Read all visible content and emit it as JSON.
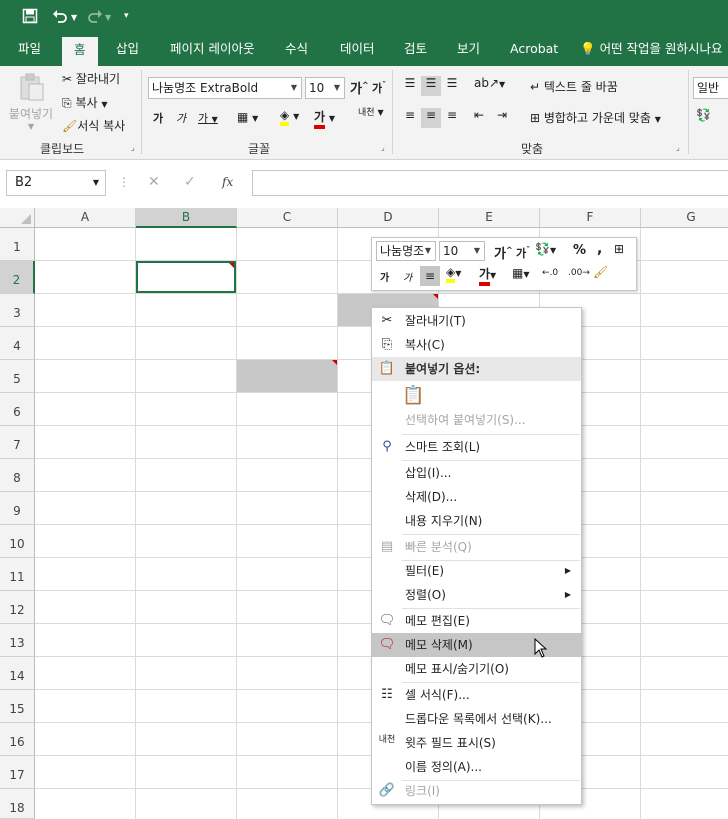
{
  "qat": {
    "save_icon": "save-icon",
    "undo_icon": "undo-icon",
    "redo_icon": "redo-icon",
    "customize_icon": "customize-icon"
  },
  "tabs": [
    {
      "label": "파일"
    },
    {
      "label": "홈"
    },
    {
      "label": "삽입"
    },
    {
      "label": "페이지 레이아웃"
    },
    {
      "label": "수식"
    },
    {
      "label": "데이터"
    },
    {
      "label": "검토"
    },
    {
      "label": "보기"
    },
    {
      "label": "Acrobat"
    }
  ],
  "tell_me": "어떤 작업을 원하시나요",
  "ribbon": {
    "clipboard": {
      "paste": "붙여넣기",
      "cut": "잘라내기",
      "copy": "복사",
      "format_painter": "서식 복사",
      "group": "클립보드"
    },
    "font": {
      "name": "나눔명조 ExtraBold",
      "size": "10",
      "group": "글꼴",
      "grow": "가",
      "shrink": "가",
      "bold": "가",
      "italic": "가",
      "underline": "가",
      "font_color_glyph": "가",
      "phonetic": "내천"
    },
    "alignment": {
      "wrap": "텍스트 줄 바꿈",
      "merge": "병합하고 가운데 맞춤",
      "group": "맞춤"
    },
    "number": {
      "format": "일반"
    }
  },
  "formula_bar": {
    "name_box": "B2",
    "fx": "fx"
  },
  "columns": [
    "A",
    "B",
    "C",
    "D",
    "E",
    "F",
    "G"
  ],
  "rows": [
    "1",
    "2",
    "3",
    "4",
    "5",
    "6",
    "7",
    "8",
    "9",
    "10",
    "11",
    "12",
    "13",
    "14",
    "15",
    "16",
    "17",
    "18"
  ],
  "mini_toolbar": {
    "font": "나눔명조",
    "size": "10",
    "percent": "%",
    "comma": ",",
    "bold": "가",
    "italic": "가",
    "font_color_glyph": "가"
  },
  "context_menu": {
    "cut": "잘라내기(T)",
    "copy": "복사(C)",
    "paste_options": "붙여넣기 옵션:",
    "paste_special": "선택하여 붙여넣기(S)...",
    "smart_lookup": "스마트 조회(L)",
    "insert": "삽입(I)...",
    "delete": "삭제(D)...",
    "clear": "내용 지우기(N)",
    "quick_analysis": "빠른 분석(Q)",
    "filter": "필터(E)",
    "sort": "정렬(O)",
    "edit_comment": "메모 편집(E)",
    "delete_comment": "메모 삭제(M)",
    "show_hide_comments": "메모 표시/숨기기(O)",
    "format_cells": "셀 서식(F)...",
    "pick_dropdown": "드롭다운 목록에서 선택(K)...",
    "phonetic_field": "윗주 필드 표시(S)",
    "define_name": "이름 정의(A)...",
    "link": "링크(I)"
  }
}
